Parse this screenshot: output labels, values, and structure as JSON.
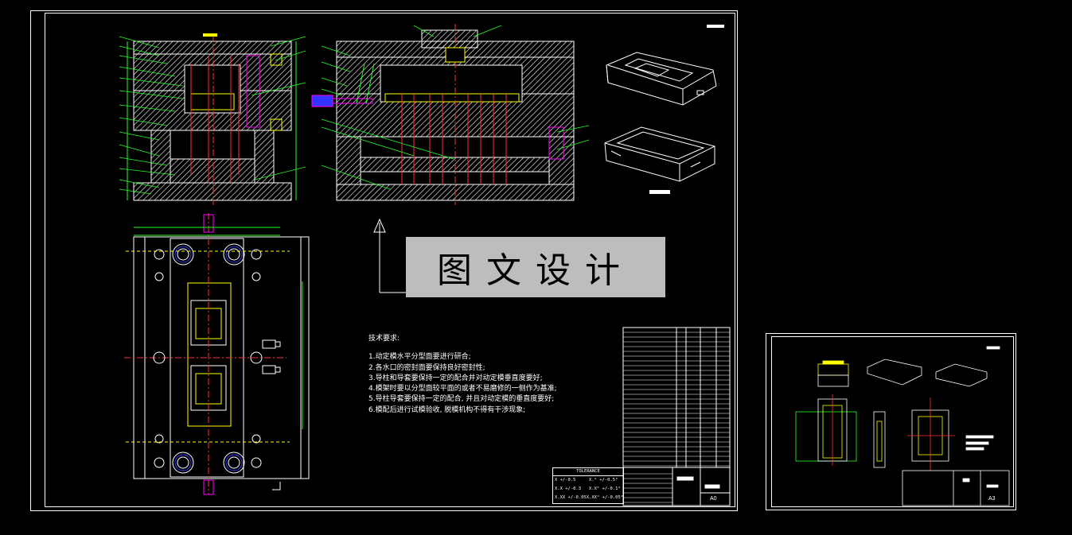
{
  "watermark": "图文设计",
  "tech_requirements": {
    "heading": "技术要求:",
    "items": [
      "1.动定模水平分型面要进行研合;",
      "2.各水口的密封面要保持良好密封性;",
      "3.导柱和导套要保持一定的配合并对动定模垂直度要好;",
      "4.模架时要以分型面较平面的或者不易磨修的一侧作为基准;",
      "5.导柱导套要保持一定的配合, 并且对动定模的垂直度要好;",
      "6.模配后进行试模验收, 脱模机构不得有干涉现象;"
    ]
  },
  "tolerance": {
    "title": "TOLERANCE",
    "rows": [
      [
        "X   +/-0.5",
        "X.°  +/-0.5°"
      ],
      [
        "X.X  +/-0.3",
        "X.X°  +/-0.1°"
      ],
      [
        "X.XX +/-0.05",
        "X.XX° +/-0.05°"
      ]
    ]
  },
  "sheet_format_main": "A0",
  "sheet_format_small": "A3"
}
